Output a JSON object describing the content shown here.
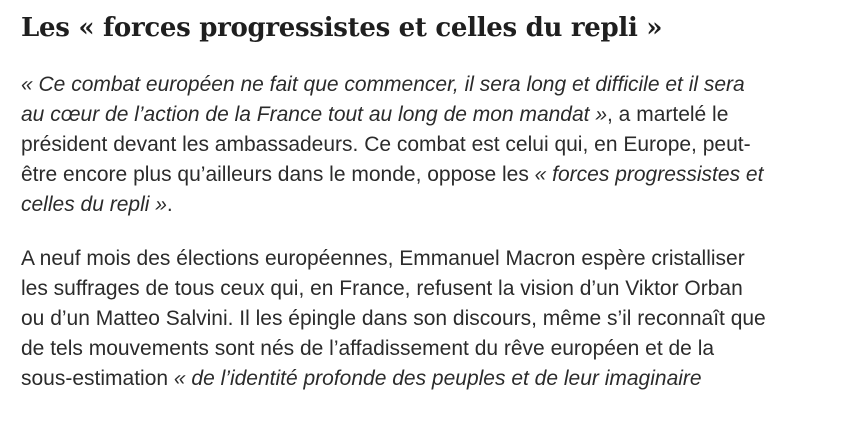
{
  "heading": "Les « forces progressistes et celles du repli »",
  "paragraph1": {
    "l1_q": "« Ce combat européen ne fait que commencer, il sera long et difficile et il sera",
    "l2_q": "au cœur de l’action de la France tout au long de mon mandat »",
    "l2_t": ", a martelé le",
    "l3": "président devant les ambassadeurs. Ce combat est celui qui, en Europe, peut-",
    "l4_t": "être encore plus qu’ailleurs dans le monde, oppose les ",
    "l4_q": "« forces progressistes et",
    "l5_q": "celles du repli »",
    "l5_t": "."
  },
  "paragraph2": {
    "l1": "A neuf mois des élections européennes, Emmanuel Macron espère cristalliser",
    "l2": "les suffrages de tous ceux qui, en France, refusent la vision d’un Viktor Orban",
    "l3": "ou d’un Matteo Salvini. Il les épingle dans son discours, même s’il reconnaît que",
    "l4": "de tels mouvements sont nés de l’affadissement du rêve européen et de la",
    "l5_t": "sous-estimation ",
    "l5_q": "« de l’identité profonde des peuples et de leur imaginaire"
  }
}
